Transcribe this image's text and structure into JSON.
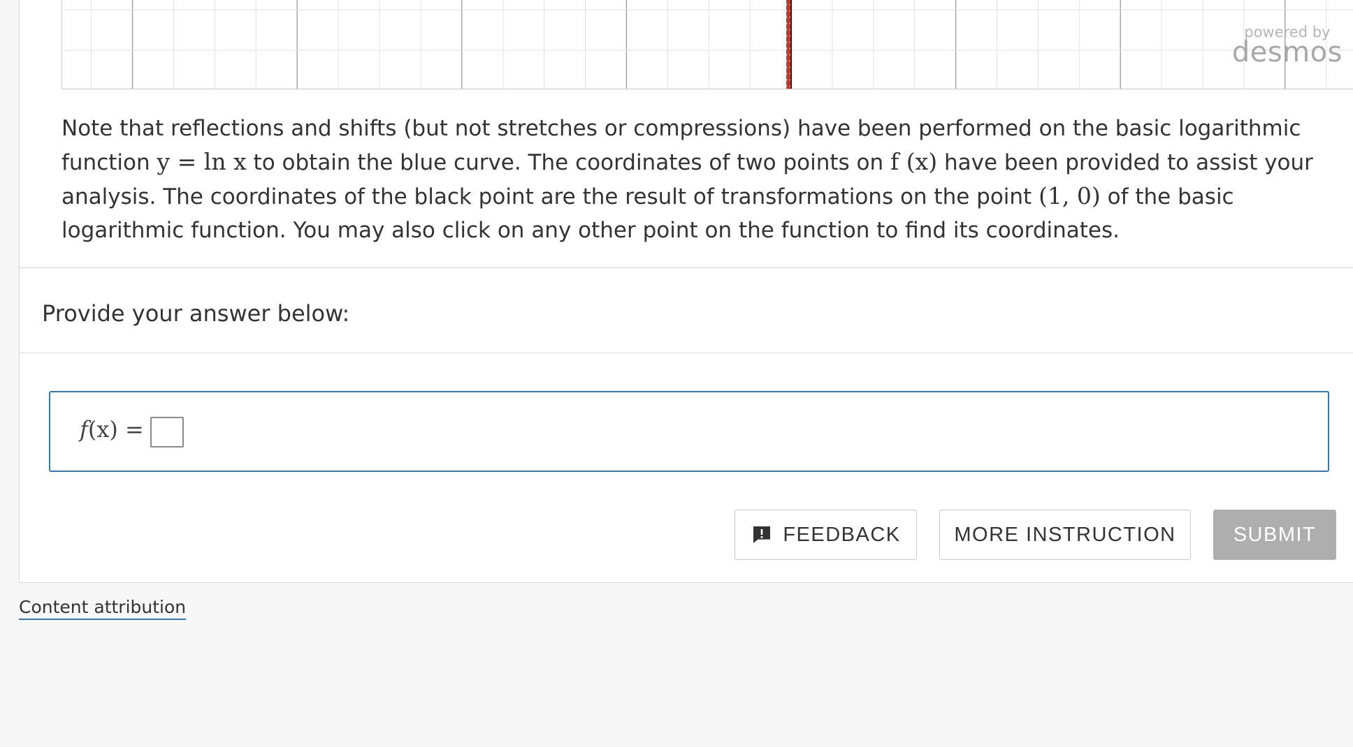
{
  "graph": {
    "badge_powered": "powered by",
    "badge_brand": "desmos",
    "asymptote_color": "#c0392b"
  },
  "question": {
    "p1": "Note that reflections and shifts (but not stretches or compressions) have been performed on the basic logarithmic function ",
    "m1": "y = ln x",
    "p2": " to obtain the blue curve. The coordinates of two points on ",
    "m2": "f (x)",
    "p3": " have been provided to assist your analysis. The coordinates of the black point are the result of transformations on the point ",
    "m3": "(1, 0)",
    "p4": " of the basic logarithmic function. You may also click on any other point on the function to find its coordinates."
  },
  "prompt": "Provide your answer below:",
  "answer": {
    "label_f": "f",
    "label_rest": "(x) =",
    "value": ""
  },
  "buttons": {
    "feedback": "FEEDBACK",
    "more": "MORE INSTRUCTION",
    "submit": "SUBMIT"
  },
  "footer": {
    "attribution": "Content attribution"
  },
  "colors": {
    "accent": "#2f7ab8",
    "submit_disabled": "#aeaeae"
  }
}
